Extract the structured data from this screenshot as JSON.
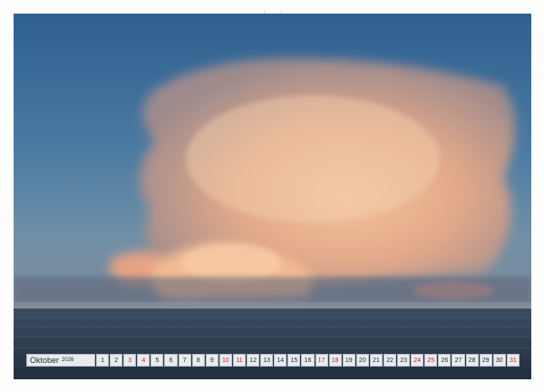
{
  "calendar": {
    "month": "Oktober",
    "year": "2026",
    "days": [
      {
        "d": "1",
        "red": false
      },
      {
        "d": "2",
        "red": false
      },
      {
        "d": "3",
        "red": true
      },
      {
        "d": "4",
        "red": true
      },
      {
        "d": "5",
        "red": false
      },
      {
        "d": "6",
        "red": false
      },
      {
        "d": "7",
        "red": false
      },
      {
        "d": "8",
        "red": false
      },
      {
        "d": "9",
        "red": false
      },
      {
        "d": "10",
        "red": true
      },
      {
        "d": "11",
        "red": true
      },
      {
        "d": "12",
        "red": false
      },
      {
        "d": "13",
        "red": false
      },
      {
        "d": "14",
        "red": false
      },
      {
        "d": "15",
        "red": false
      },
      {
        "d": "16",
        "red": false
      },
      {
        "d": "17",
        "red": true
      },
      {
        "d": "18",
        "red": true
      },
      {
        "d": "19",
        "red": false
      },
      {
        "d": "20",
        "red": false
      },
      {
        "d": "21",
        "red": false
      },
      {
        "d": "22",
        "red": false
      },
      {
        "d": "23",
        "red": false
      },
      {
        "d": "24",
        "red": true
      },
      {
        "d": "25",
        "red": true
      },
      {
        "d": "26",
        "red": false
      },
      {
        "d": "27",
        "red": false
      },
      {
        "d": "28",
        "red": false
      },
      {
        "d": "29",
        "red": false
      },
      {
        "d": "30",
        "red": false
      },
      {
        "d": "31",
        "red": true
      }
    ],
    "colors": {
      "weekend": "#d1232b",
      "weekday": "#1f2a36",
      "cell_bg": "#e9ecef"
    }
  },
  "photo": {
    "subject": "cumulonimbus-cloud-over-sea",
    "sky_color": "#3f6f9a",
    "cloud_color": "#e9b58c",
    "sea_color": "#2b3a4d"
  }
}
